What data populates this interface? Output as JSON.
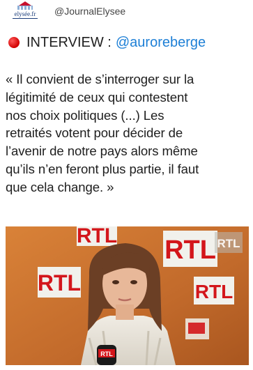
{
  "header": {
    "logo_text": "elysée.fr",
    "handle": "@JournalElysee"
  },
  "headline": {
    "label": "INTERVIEW :",
    "mention": "@auroreberge"
  },
  "quote": {
    "lines": [
      "« Il convient de s’interroger sur la",
      "légitimité de ceux qui contestent",
      "nos choix politiques (...) Les",
      "retraités votent pour décider de",
      "l’avenir de notre pays alors même",
      "qu’ils n’en feront plus partie, il faut",
      "que cela change. »"
    ]
  },
  "photo": {
    "logos": [
      "RTL",
      "RTL",
      "RTL",
      "RTL",
      "RTL"
    ],
    "mic_label": "RTL",
    "colors": {
      "wall": "#c9722f",
      "logo_bg": "#f1f1ec",
      "logo_red": "#d3161b",
      "skin": "#e8b899",
      "hair": "#6b3f25"
    }
  }
}
